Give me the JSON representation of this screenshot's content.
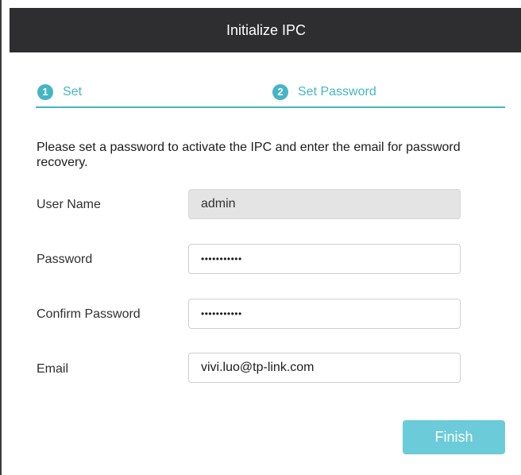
{
  "dialog": {
    "title": "Initialize IPC"
  },
  "steps": [
    {
      "number": "1",
      "label": "Set"
    },
    {
      "number": "2",
      "label": "Set Password"
    }
  ],
  "description": "Please set a password to activate the IPC and enter the email for password recovery.",
  "form": {
    "username": {
      "label": "User Name",
      "value": "admin"
    },
    "password": {
      "label": "Password",
      "value": "•••••••••••"
    },
    "confirm_password": {
      "label": "Confirm Password",
      "value": "•••••••••••"
    },
    "email": {
      "label": "Email",
      "value": "vivi.luo@tp-link.com"
    }
  },
  "buttons": {
    "finish_label": "Finish"
  },
  "colors": {
    "accent": "#45b5c6",
    "button": "#6ccbd8",
    "titlebar": "#2e2e30"
  }
}
